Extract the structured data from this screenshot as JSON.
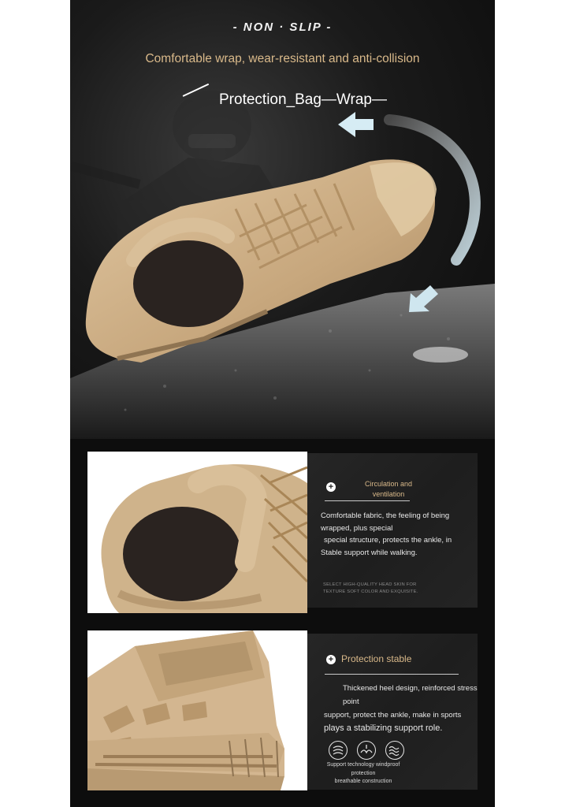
{
  "hero": {
    "tagline": "- NON · SLIP -",
    "subtitle": "Comfortable wrap, wear-resistant and anti-collision",
    "callout": "Protection_Bag—Wrap—"
  },
  "features": [
    {
      "title_line1": "Circulation and",
      "title_line2": "ventilation",
      "body_line1": "Comfortable fabric, the feeling of being wrapped, plus special",
      "body_line2": "special structure, protects the ankle, in",
      "body_line3": "Stable support while walking.",
      "fine_line1": "SELECT HIGH-QUALITY HEAD SKIN FOR",
      "fine_line2": "TEXTURE SOFT COLOR AND EXQUISITE."
    },
    {
      "title": "Protection stable",
      "body_line1": "Thickened heel design, reinforced stress point",
      "body_line2": "support, protect the ankle, make in sports",
      "body_line3": "plays a stabilizing support role.",
      "icon_caption_line1": "Support technology windproof protection",
      "icon_caption_line2": "breathable construction",
      "icons": [
        "windproof-icon",
        "breathable-icon",
        "wave-protection-icon"
      ]
    }
  ],
  "colors": {
    "accent_tan": "#d9b98a",
    "boot_tan": "#c9ab83",
    "background": "#0d0d0d",
    "card": "#222222"
  }
}
